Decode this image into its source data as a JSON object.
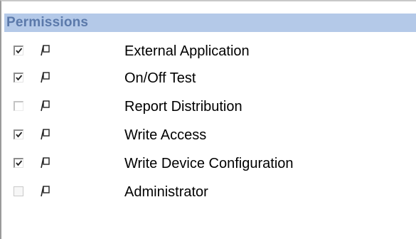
{
  "panel": {
    "title": "Permissions"
  },
  "permissions": [
    {
      "label": "External Application",
      "checked": true,
      "enabled": true
    },
    {
      "label": "On/Off Test",
      "checked": true,
      "enabled": true
    },
    {
      "label": "Report Distribution",
      "checked": false,
      "enabled": false
    },
    {
      "label": "Write Access",
      "checked": true,
      "enabled": true
    },
    {
      "label": "Write Device Configuration",
      "checked": true,
      "enabled": true
    },
    {
      "label": "Administrator",
      "checked": false,
      "enabled": false
    }
  ],
  "icons": {
    "secondary_column": "flag-icon",
    "checkmark": "checkmark-icon"
  },
  "colors": {
    "header_bg": "#b4c9e8",
    "header_text": "#5b79aa"
  }
}
